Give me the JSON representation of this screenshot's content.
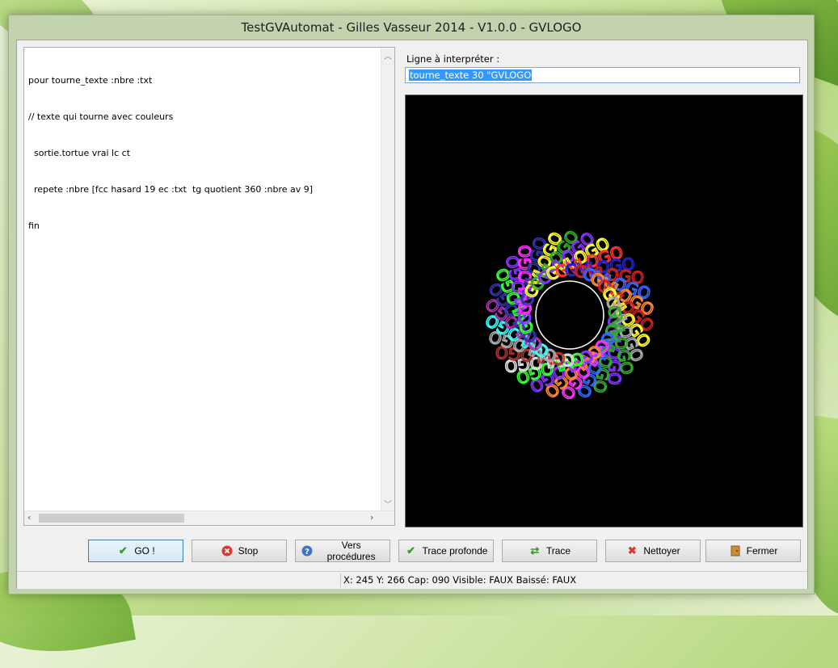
{
  "window": {
    "title": "TestGVAutomat - Gilles Vasseur 2014 - V1.0.0 - GVLOGO"
  },
  "editor": {
    "lines": [
      "pour tourne_texte :nbre :txt",
      "// texte qui tourne avec couleurs",
      "  sortie.tortue vrai lc ct",
      "  repete :nbre [fcc hasard 19 ec :txt  tg quotient 360 :nbre av 9]",
      "fin"
    ]
  },
  "interpreter": {
    "label": "Ligne à interpréter :",
    "value": "tourne_texte 30 \"GVLOGO"
  },
  "canvas": {
    "text": "GVLOGO",
    "repeat_count": 30
  },
  "buttons": {
    "go": {
      "label": "GO !",
      "icon": "check-icon"
    },
    "stop": {
      "label": "Stop",
      "icon": "stop-icon"
    },
    "procedures": {
      "label": "Vers procédures",
      "icon": "help-icon"
    },
    "deep_trace": {
      "label": "Trace profonde",
      "icon": "check-icon"
    },
    "trace": {
      "label": "Trace",
      "icon": "refresh-icon"
    },
    "clear": {
      "label": "Nettoyer",
      "icon": "x-icon"
    },
    "close": {
      "label": "Fermer",
      "icon": "door-icon"
    }
  },
  "status": {
    "text": "X: 245 Y: 266 Cap: 090 Visible: FAUX Baissé: FAUX"
  },
  "colors": {
    "canvas_bg": "#000000",
    "selection": "#3399ff",
    "accent": "#3c7fb1"
  }
}
